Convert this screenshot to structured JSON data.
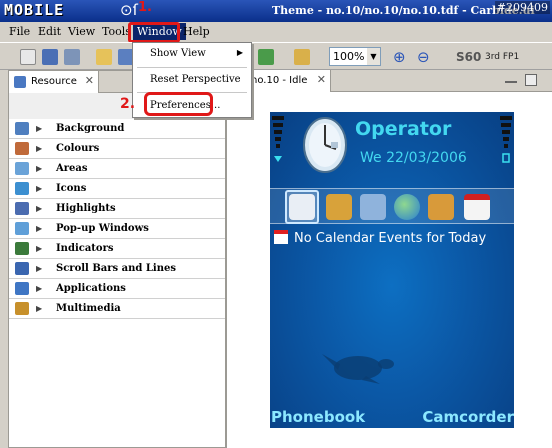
{
  "window": {
    "logo": "MOBILE",
    "title": "Theme - no.10/no.10/no.10.tdf - Carbide.ui",
    "watermark": "#209409"
  },
  "menubar": {
    "items": [
      "File",
      "Edit",
      "View",
      "Tools",
      "Window",
      "Help"
    ],
    "active": "Window"
  },
  "annotations": {
    "step1": "1.",
    "step2": "2."
  },
  "dropdown": {
    "items": [
      "Show View",
      "Reset Perspective",
      "Preferences..."
    ]
  },
  "toolbar": {
    "zoom": "100%",
    "platform": "S60",
    "resolution": "3rd FP1"
  },
  "left_panel": {
    "tab_label": "Resource",
    "items": [
      {
        "label": "Background",
        "icon": "background-icon",
        "color": "#4f7fbf"
      },
      {
        "label": "Colours",
        "icon": "colours-icon",
        "color": "#c06a3a"
      },
      {
        "label": "Areas",
        "icon": "areas-icon",
        "color": "#6aa3d8"
      },
      {
        "label": "Icons",
        "icon": "icons-icon",
        "color": "#3c8fd0"
      },
      {
        "label": "Highlights",
        "icon": "highlights-icon",
        "color": "#4b6cb0"
      },
      {
        "label": "Pop-up Windows",
        "icon": "popup-icon",
        "color": "#5f9fd8"
      },
      {
        "label": "Indicators",
        "icon": "indicators-icon",
        "color": "#3b7a3b"
      },
      {
        "label": "Scroll Bars and Lines",
        "icon": "scrollbars-icon",
        "color": "#3a66b0"
      },
      {
        "label": "Applications",
        "icon": "applications-icon",
        "color": "#3f76c4"
      },
      {
        "label": "Multimedia",
        "icon": "multimedia-icon",
        "color": "#c7902b"
      }
    ]
  },
  "editor": {
    "tab_label": "no.10 - Idle"
  },
  "phone": {
    "operator": "Operator",
    "date": "We 22/03/2006",
    "calendar_text": "No Calendar Events for Today",
    "softkey_left": "Phonebook",
    "softkey_right": "Camcorder"
  }
}
